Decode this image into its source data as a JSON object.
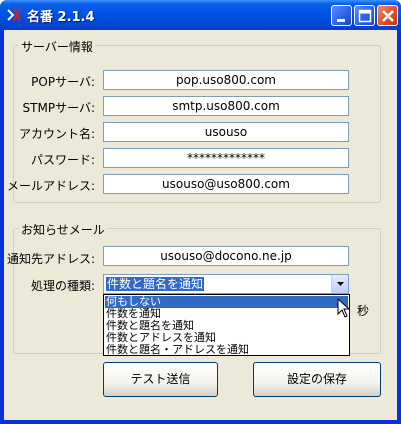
{
  "window": {
    "title": "名番 2.1.4",
    "controls": {
      "minimize": "minimize-icon",
      "maximize": "maximize-icon",
      "close": "close-icon"
    }
  },
  "server_group": {
    "label": "サーバー情報",
    "fields": {
      "pop": {
        "label": "POPサーバ:",
        "value": "pop.uso800.com"
      },
      "smtp": {
        "label": "STMPサーバ:",
        "value": "smtp.uso800.com"
      },
      "account": {
        "label": "アカウント名:",
        "value": "usouso"
      },
      "password": {
        "label": "パスワード:",
        "value": "*************"
      },
      "email": {
        "label": "メールアドレス:",
        "value": "usouso@uso800.com"
      }
    }
  },
  "notify_group": {
    "label": "お知らせメール",
    "address": {
      "label": "通知先アドレス:",
      "value": "usouso@docono.ne.jp"
    },
    "method": {
      "label": "処理の種類:",
      "selected": "件数と題名を通知",
      "options": [
        "何もしない",
        "件数を通知",
        "件数と題名を通知",
        "件数とアドレスを通知",
        "件数と題名・アドレスを通知"
      ],
      "highlighted": "何もしない"
    },
    "unit_suffix": "秒"
  },
  "buttons": {
    "test_send": "テスト送信",
    "save_settings": "設定の保存"
  },
  "colors": {
    "titlebar": "#0055e5",
    "selection": "#316ac5",
    "dialog_bg": "#ece9d8",
    "field_border": "#7f9db9"
  }
}
